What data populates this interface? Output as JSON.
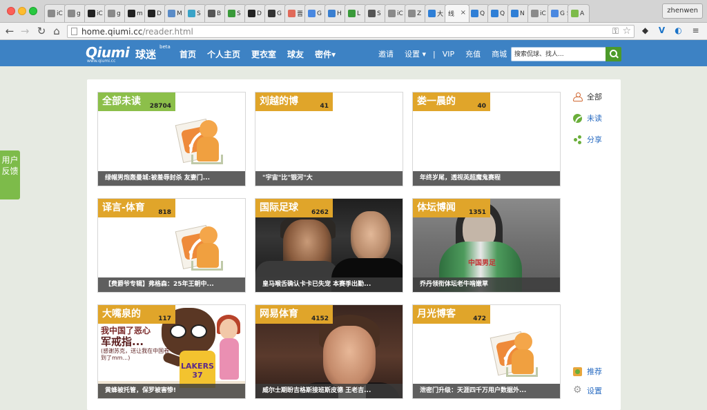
{
  "browser": {
    "tabs": [
      {
        "text": "iC",
        "fav": "#8a8a8a"
      },
      {
        "text": "g",
        "fav": "#8a8a8a"
      },
      {
        "text": "iC",
        "fav": "#222222"
      },
      {
        "text": "g",
        "fav": "#8a8a8a"
      },
      {
        "text": "m",
        "fav": "#222222"
      },
      {
        "text": "D",
        "fav": "#222222"
      },
      {
        "text": "M",
        "fav": "#5b8cc7"
      },
      {
        "text": "S",
        "fav": "#3ba3c7"
      },
      {
        "text": "B",
        "fav": "#555555"
      },
      {
        "text": "S",
        "fav": "#3a9a3a"
      },
      {
        "text": "D",
        "fav": "#222222"
      },
      {
        "text": "G",
        "fav": "#333333"
      },
      {
        "text": "晋",
        "fav": "#e06a5a"
      },
      {
        "text": "G",
        "fav": "#4a88e0"
      },
      {
        "text": "H",
        "fav": "#3a7fd0"
      },
      {
        "text": "L",
        "fav": "#3a9a3a"
      },
      {
        "text": "S",
        "fav": "#555555"
      },
      {
        "text": "iC",
        "fav": "#8a8a8a"
      },
      {
        "text": "Z",
        "fav": "#8a8a8a"
      },
      {
        "text": "大",
        "fav": "#2f7fd6"
      }
    ],
    "active_tab": {
      "text": "线",
      "close": "×"
    },
    "tabs_after": [
      {
        "text": "Q",
        "fav": "#2f7fd6"
      },
      {
        "text": "Q",
        "fav": "#2f7fd6"
      },
      {
        "text": "N",
        "fav": "#2f7fd6"
      },
      {
        "text": "iC",
        "fav": "#8a8a8a"
      },
      {
        "text": "G S",
        "fav": "#4a88e0"
      },
      {
        "text": "A",
        "fav": "#7dbb4a"
      }
    ],
    "user": "zhenwen",
    "url_host": "home.qiumi.cc",
    "url_path": "/reader.html"
  },
  "header": {
    "brand": "Qiumi",
    "brand_cn": "球迷",
    "beta": "beta",
    "domain": "www.qiumi.cc",
    "nav": [
      "首页",
      "个人主页",
      "更衣室",
      "球友",
      "密件▾"
    ],
    "subnav": {
      "invite": "邀请",
      "settings": "设置 ▾",
      "sep": "|",
      "vip": "VIP",
      "recharge": "充值",
      "mall": "商城"
    },
    "search_placeholder": "搜索侃球、找人..."
  },
  "feedback": [
    "用户",
    "反馈"
  ],
  "cards": [
    {
      "label": "全部未读",
      "count": "28704",
      "caption": "绿帽男炮轰曼城:被羞辱封杀 友妻门...",
      "color": "#8cbf4a",
      "art": "rss"
    },
    {
      "label": "刘越的博",
      "count": "41",
      "caption": "\"宇宙\"比\"银河\"大",
      "color": "#e0a52a",
      "art": "blank"
    },
    {
      "label": "娄一晨的",
      "count": "40",
      "caption": "年终岁尾，透视英超魔鬼赛程",
      "color": "#e0a52a",
      "art": "blank"
    },
    {
      "label": "译言-体育",
      "count": "818",
      "caption": "【费爵爷专辑】弗格森：25年王朝中...",
      "color": "#e0a52a",
      "art": "rss"
    },
    {
      "label": "国际足球",
      "count": "6262",
      "caption": "皇马喉舌确认卡卡已失宠 本赛季出勤...",
      "color": "#e0a52a",
      "art": "soccer"
    },
    {
      "label": "体坛博闻",
      "count": "1351",
      "caption": "乔丹领衔体坛老牛啃嫩草",
      "color": "#e0a52a",
      "art": "forum",
      "shirt_text": "中国男足"
    },
    {
      "label": "大嘴泉的",
      "count": "117",
      "caption": "黄蜂被托管，保罗被害惨!",
      "color": "#e0a52a",
      "art": "cartoon",
      "cartoon": {
        "line1": "我中国了恶心",
        "line2": "军戒指...",
        "line3": "(感谢苏克，送让我在中国卷到了mm...)",
        "jersey": "LAKERS 37"
      }
    },
    {
      "label": "网易体育",
      "count": "4152",
      "caption": "威尔士期盼吉格斯接班斯皮德 王老吉...",
      "color": "#e0a52a",
      "art": "beckham"
    },
    {
      "label": "月光博客",
      "count": "472",
      "caption": "泄密门升级：天涯四千万用户数据外...",
      "color": "#e0a52a",
      "art": "rss"
    }
  ],
  "sidenav_top": [
    {
      "label": "全部",
      "icon": "all-icon",
      "current": true
    },
    {
      "label": "未读",
      "icon": "rss-icon",
      "current": false
    },
    {
      "label": "分享",
      "icon": "share-icon",
      "current": false
    }
  ],
  "sidenav_bottom": [
    {
      "label": "推荐",
      "icon": "recommend-icon"
    },
    {
      "label": "设置",
      "icon": "settings-icon"
    }
  ]
}
